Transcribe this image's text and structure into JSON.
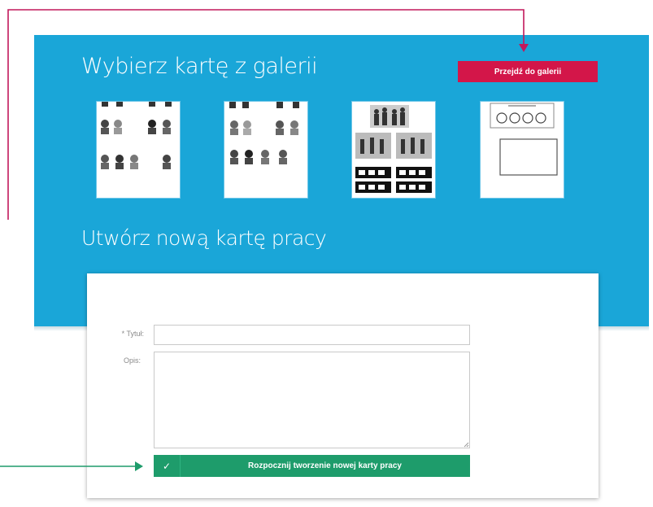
{
  "gallery": {
    "title": "Wybierz kartę z galerii",
    "button_label": "Przejdź do galerii",
    "thumbnails": [
      {
        "icon": "people-faces-worksheet"
      },
      {
        "icon": "people-faces-worksheet-2"
      },
      {
        "icon": "sports-scenes-worksheet"
      },
      {
        "icon": "symbols-box-worksheet"
      }
    ]
  },
  "create": {
    "title": "Utwórz nową kartę pracy",
    "title_label": "* Tytuł:",
    "title_value": "",
    "description_label": "Opis:",
    "description_value": "",
    "start_button_label": "Rozpocznij tworzenie nowej karty pracy",
    "start_button_icon": "✓"
  },
  "colors": {
    "panel": "#1aa6d8",
    "gallery_button": "#d31649",
    "start_button": "#1e9c6b",
    "arrow_red": "#c2185b",
    "arrow_green": "#1e9c6b"
  }
}
